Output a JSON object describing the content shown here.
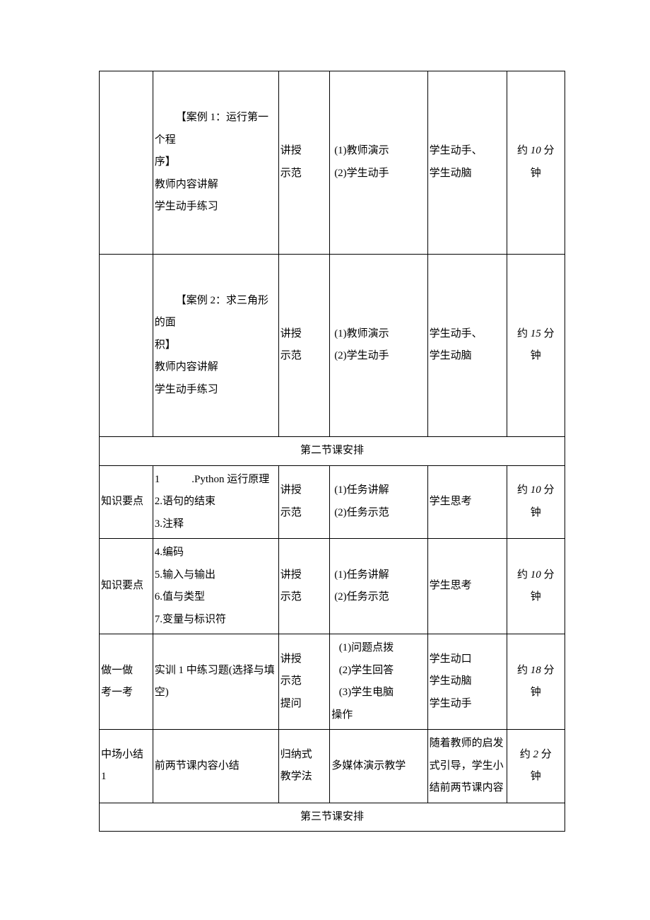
{
  "rows": [
    {
      "c1": "",
      "c2_block": {
        "line1_indent": "【案例 1：运行第一个程",
        "line2": "序】",
        "line3": "教师内容讲解",
        "line4": "学生动手练习"
      },
      "c3": {
        "l1": "讲授",
        "l2": "示范"
      },
      "c4": {
        "l1": "(1)教师演示",
        "l2": "(2)学生动手"
      },
      "c5": {
        "l1": "学生动手、",
        "l2": "学生动脑"
      },
      "c6": {
        "prefix": "约 ",
        "num": "10",
        "unit": " 分",
        "tail": "钟"
      }
    },
    {
      "c1": "",
      "c2_block": {
        "line1_indent": "【案例 2：求三角形的面",
        "line2": "积】",
        "line3": "教师内容讲解",
        "line4": "学生动手练习"
      },
      "c3": {
        "l1": "讲授",
        "l2": "示范"
      },
      "c4": {
        "l1": "(1)教师演示",
        "l2": "(2)学生动手"
      },
      "c5": {
        "l1": "学生动手、",
        "l2": "学生动脑"
      },
      "c6": {
        "prefix": "约 ",
        "num": "15",
        "unit": " 分",
        "tail": "钟"
      }
    }
  ],
  "section2_header": "第二节课安排",
  "section2_rows": [
    {
      "c1": "知识要点",
      "c2_list": [
        "1　　　.Python 运行原理",
        "2.语句的结束",
        "3.注释"
      ],
      "c3": {
        "l1": "讲授",
        "l2": "示范"
      },
      "c4": {
        "l1": "(1)任务讲解",
        "l2": "(2)任务示范"
      },
      "c5_single": "学生思考",
      "c6": {
        "prefix": "约 ",
        "num": "10",
        "unit": " 分",
        "tail": "钟"
      }
    },
    {
      "c1": "知识要点",
      "c2_list": [
        "4.编码",
        "5.输入与输出",
        "6.值与类型",
        "7.变量与标识符"
      ],
      "c3": {
        "l1": "讲授",
        "l2": "示范"
      },
      "c4": {
        "l1": "(1)任务讲解",
        "l2": "(2)任务示范"
      },
      "c5_single": "学生思考",
      "c6": {
        "prefix": "约 ",
        "num": "10",
        "unit": " 分",
        "tail": "钟"
      }
    },
    {
      "c1_2line": {
        "l1": "做一做",
        "l2": "考一考"
      },
      "c2_text": "实训 1 中练习题(选择与填空)",
      "c3_3": {
        "l1": "讲授",
        "l2": "示范",
        "l3": "提问"
      },
      "c4_4": {
        "l1": "(1)问题点拨",
        "l2": "(2)学生回答",
        "l3": "(3)学生电脑",
        "l4": "操作"
      },
      "c5_3": {
        "l1": "学生动口",
        "l2": "学生动脑",
        "l3": "学生动手"
      },
      "c6": {
        "prefix": "约 ",
        "num": "18",
        "unit": " 分",
        "tail": "钟"
      }
    },
    {
      "c1": "中场小结 1",
      "c2_text": "前两节课内容小结",
      "c3_2": {
        "l1": "归纳式",
        "l2": "教学法"
      },
      "c4_single": "多媒体演示教学",
      "c5_text": "随着教师的启发式引导，学生小结前两节课内容",
      "c6": {
        "prefix": "约 ",
        "num": "2",
        "unit": " 分",
        "tail": "钟"
      }
    }
  ],
  "section3_header": "第三节课安排"
}
